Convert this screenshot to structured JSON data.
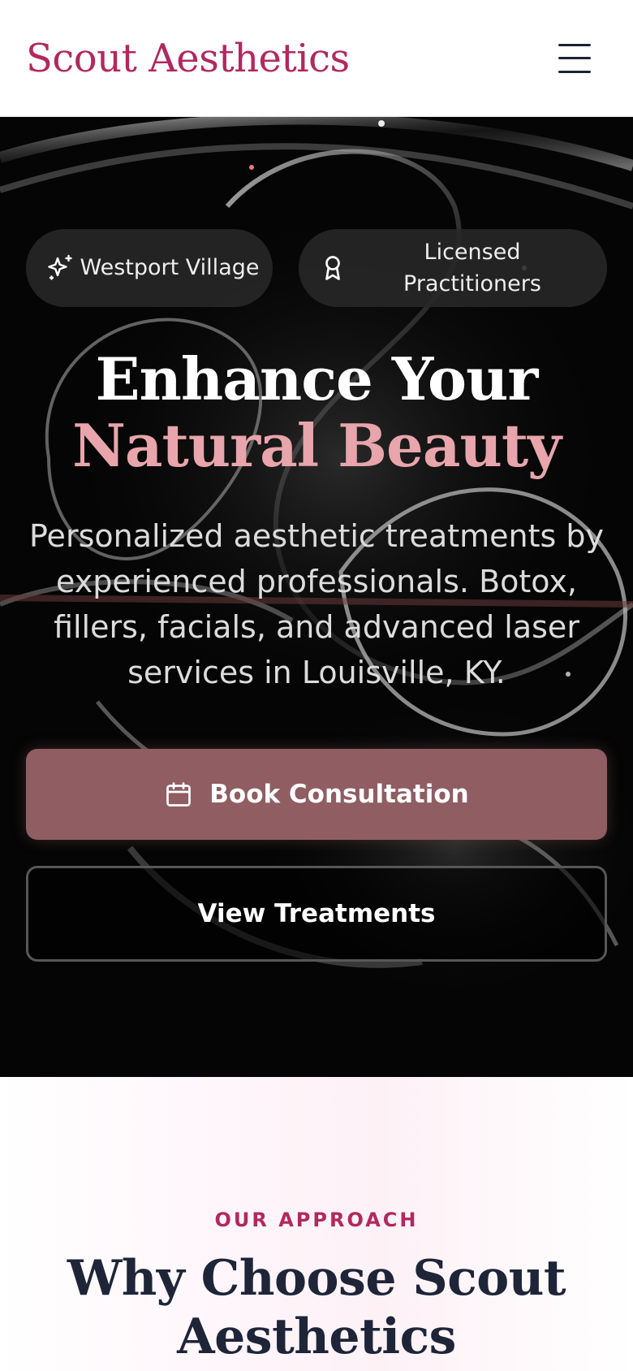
{
  "header": {
    "brand": "Scout Aesthetics",
    "menu_icon": "hamburger-menu-icon"
  },
  "hero": {
    "badges": [
      {
        "icon": "sparkles-icon",
        "label": "Westport Village"
      },
      {
        "icon": "award-ribbon-icon",
        "label": "Licensed Practitioners"
      }
    ],
    "headline_line1": "Enhance Your",
    "headline_line2": "Natural Beauty",
    "subtitle": "Personalized aesthetic treatments by experienced professionals. Botox, fillers, facials, and advanced laser services in Louisville, KY.",
    "primary_cta": {
      "icon": "calendar-icon",
      "label": "Book Consultation"
    },
    "secondary_cta": {
      "label": "View Treatments"
    }
  },
  "approach": {
    "eyebrow": "OUR APPROACH",
    "title": "Why Choose Scout Aesthetics"
  },
  "colors": {
    "brand": "#b2285f",
    "accent_pink": "#e8a5ab",
    "button_mauve": "#8f5d62",
    "heading_navy": "#1e2538",
    "hero_background": "#050505"
  }
}
